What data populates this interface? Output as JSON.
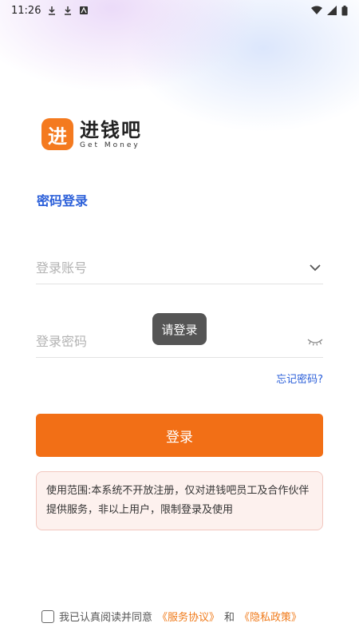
{
  "status_bar": {
    "time": "11:26"
  },
  "logo": {
    "badge_glyph": "进",
    "name_cn": "进钱吧",
    "name_en": "Get Money",
    "color": "#f47a1f"
  },
  "login": {
    "title": "密码登录",
    "account_placeholder": "登录账号",
    "password_placeholder": "登录密码",
    "forgot_label": "忘记密码?",
    "button_label": "登录",
    "toast": "请登录"
  },
  "notice": {
    "text": "使用范围:本系统不开放注册，仅对进钱吧员工及合作伙伴提供服务，非以上用户，限制登录及使用"
  },
  "agreement": {
    "prefix": "我已认真阅读并同意",
    "service": "《服务协议》",
    "and": "和",
    "privacy": "《隐私政策》"
  },
  "colors": {
    "accent_orange": "#f26f16",
    "link_blue": "#2b5fd9"
  }
}
